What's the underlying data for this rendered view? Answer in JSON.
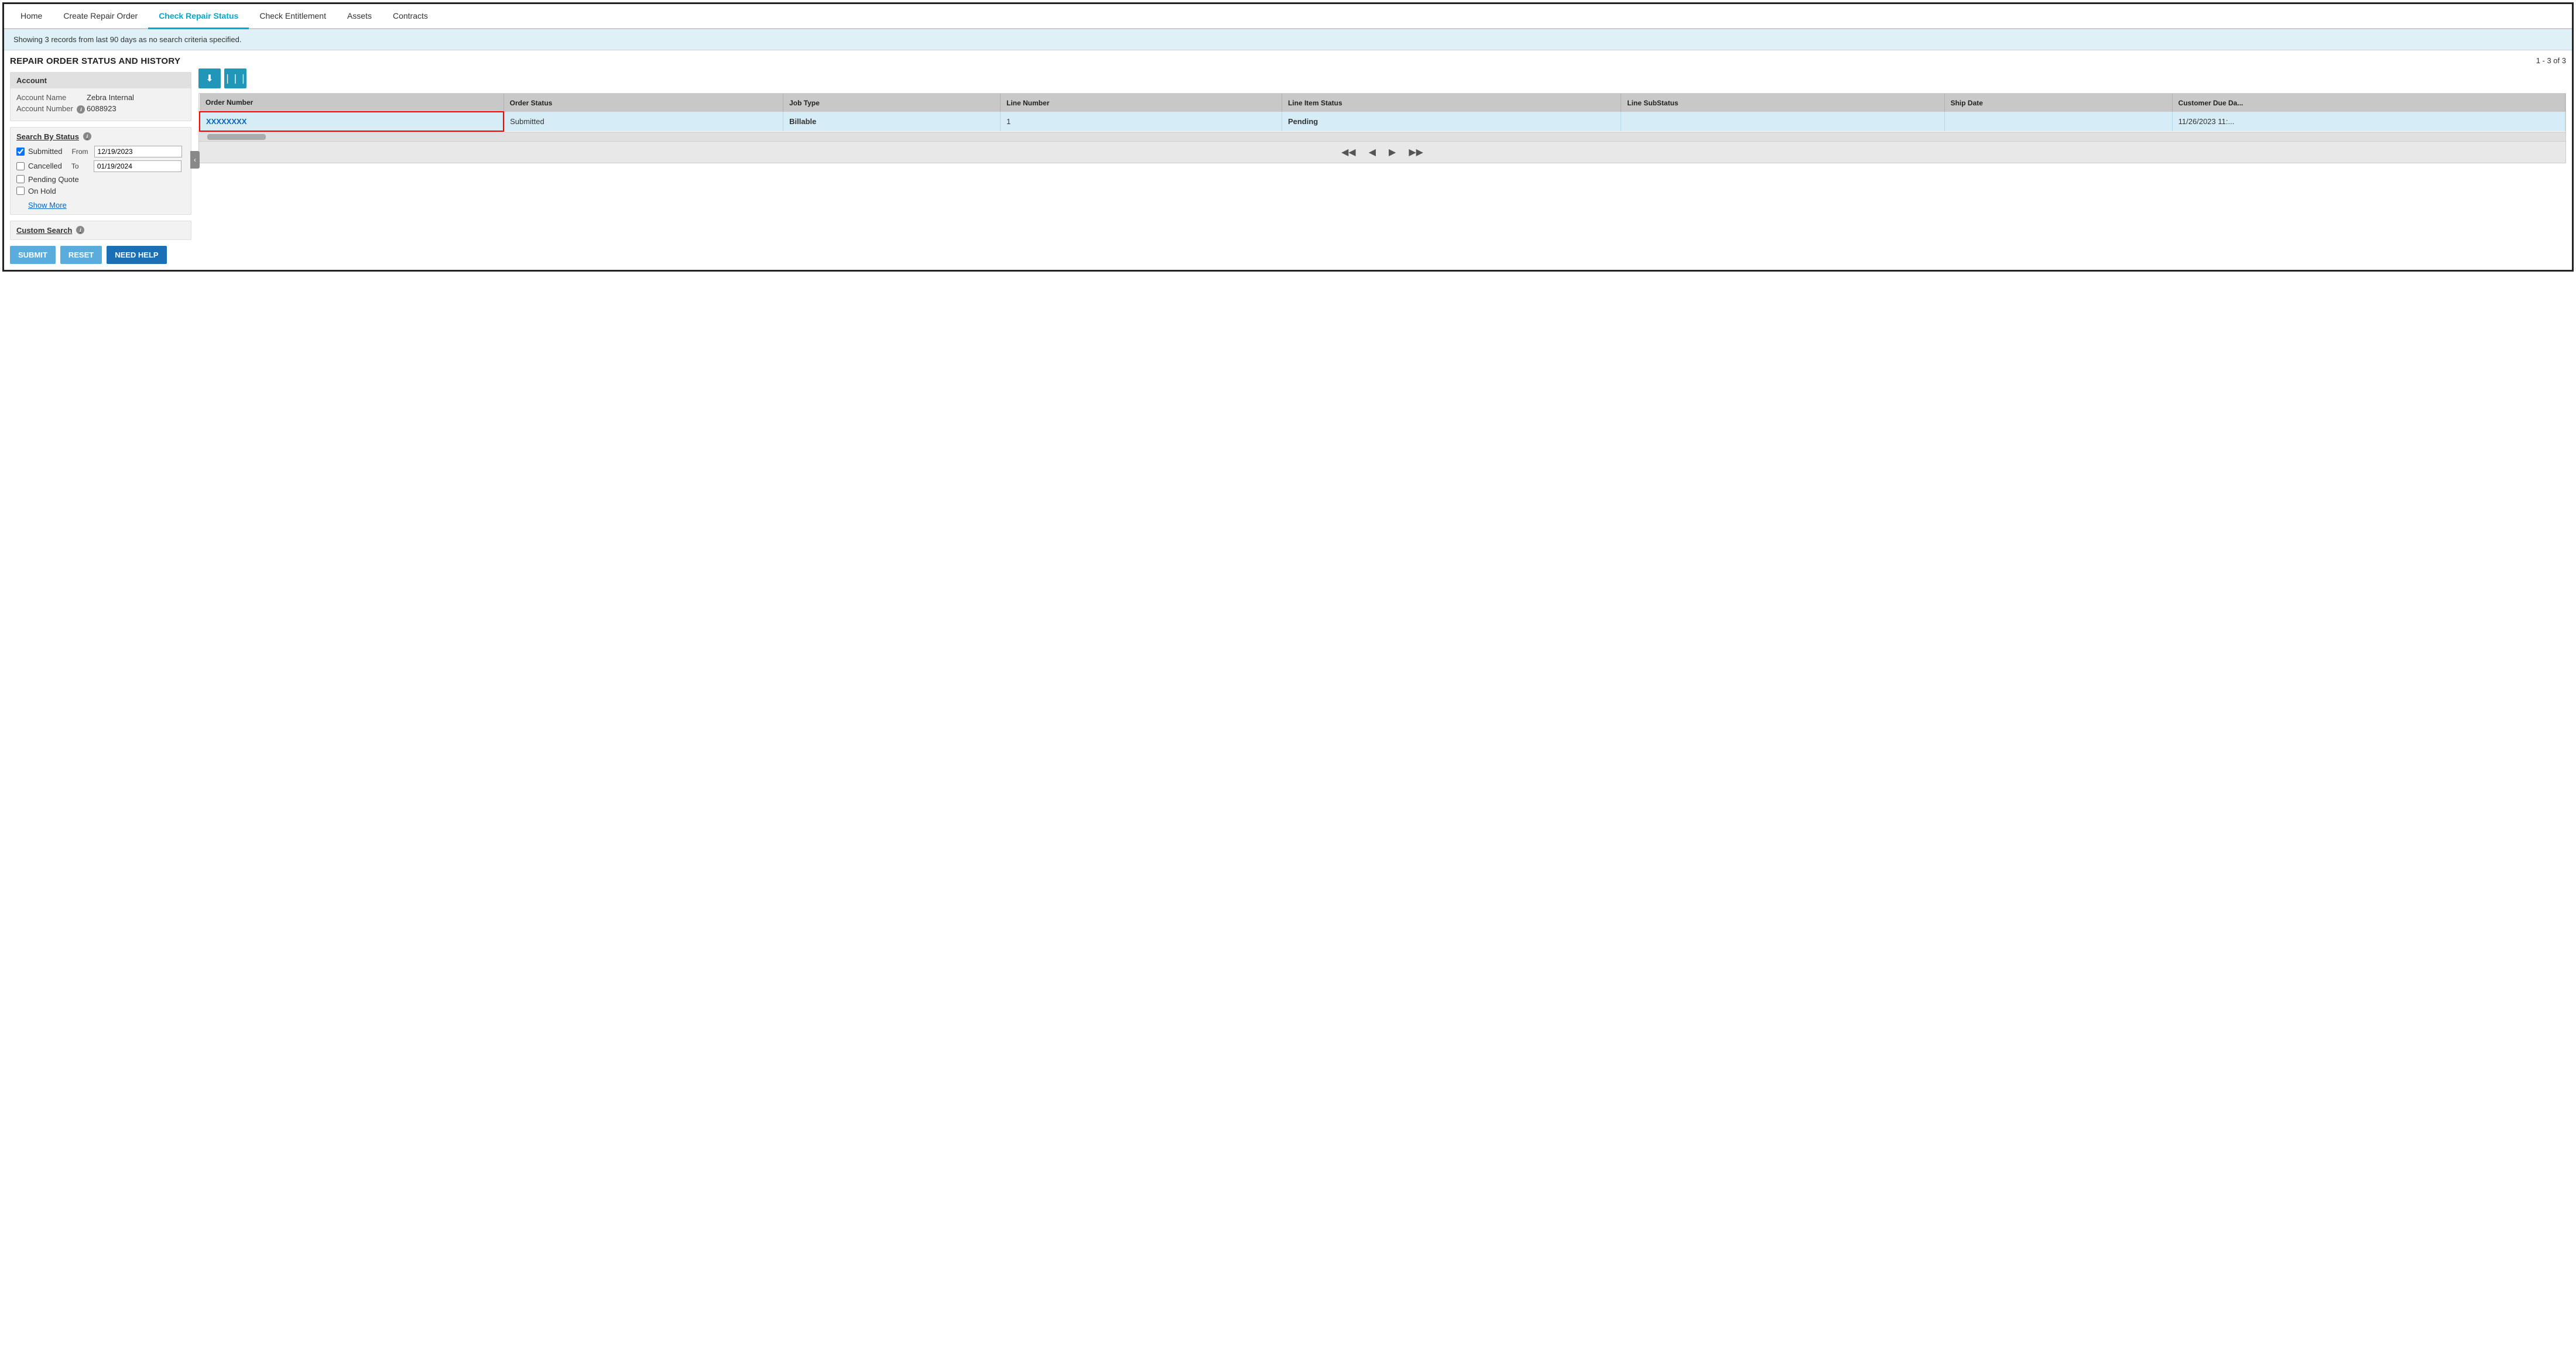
{
  "nav": {
    "items": [
      {
        "id": "home",
        "label": "Home",
        "active": false
      },
      {
        "id": "create-repair-order",
        "label": "Create Repair Order",
        "active": false
      },
      {
        "id": "check-repair-status",
        "label": "Check Repair Status",
        "active": true
      },
      {
        "id": "check-entitlement",
        "label": "Check Entitlement",
        "active": false
      },
      {
        "id": "assets",
        "label": "Assets",
        "active": false
      },
      {
        "id": "contracts",
        "label": "Contracts",
        "active": false
      }
    ]
  },
  "banner": {
    "text": "Showing 3 records from last 90 days as no search criteria specified."
  },
  "left_panel": {
    "section_title": "REPAIR ORDER STATUS AND HISTORY",
    "account": {
      "header": "Account",
      "name_label": "Account Name",
      "name_value": "Zebra Internal",
      "number_label": "Account Number",
      "number_value": "6088923"
    },
    "search_by_status": {
      "title": "Search By Status",
      "from_label": "From",
      "from_value": "12/19/2023",
      "to_label": "To",
      "to_value": "01/19/2024",
      "checkboxes": [
        {
          "id": "submitted",
          "label": "Submitted",
          "checked": true
        },
        {
          "id": "cancelled",
          "label": "Cancelled",
          "checked": false
        },
        {
          "id": "pending-quote",
          "label": "Pending Quote",
          "checked": false
        },
        {
          "id": "on-hold",
          "label": "On Hold",
          "checked": false
        }
      ],
      "show_more": "Show More"
    },
    "custom_search": {
      "title": "Custom Search"
    },
    "buttons": {
      "submit": "SUBMIT",
      "reset": "RESET",
      "need_help": "NEED HELP"
    }
  },
  "right_panel": {
    "record_count": "1 - 3 of 3",
    "toolbar": {
      "download_icon": "⬇",
      "columns_icon": "⫶"
    },
    "table": {
      "columns": [
        "Order Number",
        "Order Status",
        "Job Type",
        "Line Number",
        "Line Item Status",
        "Line SubStatus",
        "Ship Date",
        "Customer Due Da..."
      ],
      "rows": [
        {
          "order_number": "XXXXXXXX",
          "order_status": "Submitted",
          "job_type": "Billable",
          "line_number": "1",
          "line_item_status": "Pending",
          "line_substatus": "",
          "ship_date": "",
          "customer_due_date": "11/26/2023 11:..."
        }
      ]
    },
    "pagination": {
      "first": "⏮",
      "prev": "◀",
      "next": "▶",
      "last": "⏭"
    }
  }
}
